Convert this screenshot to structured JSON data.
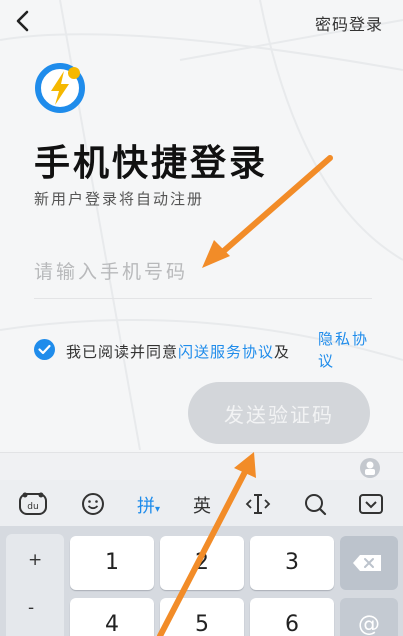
{
  "header": {
    "back_icon": "chevron-left-icon",
    "password_login": "密码登录"
  },
  "logo": {
    "icon": "lightning-bolt-logo"
  },
  "title": "手机快捷登录",
  "subtitle": "新用户登录将自动注册",
  "phone_input": {
    "placeholder": "请输入手机号码",
    "value": ""
  },
  "agreement": {
    "checked": true,
    "prefix": "我已阅读并同意",
    "link1": "闪送服务协议",
    "and": "及",
    "link2": "隐私协议"
  },
  "send_button": {
    "label": "发送验证码"
  },
  "keyboard": {
    "toolbar": [
      {
        "icon": "du-logo-icon"
      },
      {
        "icon": "emoji-icon"
      },
      {
        "label": "拼",
        "active": true,
        "suffix": "▾"
      },
      {
        "label": "英"
      },
      {
        "icon": "cursor-icon"
      },
      {
        "icon": "search-icon"
      },
      {
        "icon": "keyboard-collapse-icon"
      }
    ],
    "side_keys": [
      "+",
      "-"
    ],
    "number_keys": [
      "1",
      "2",
      "3",
      "4",
      "5",
      "6"
    ],
    "func_keys": [
      {
        "icon": "backspace-icon"
      },
      {
        "label": "@"
      }
    ]
  },
  "colors": {
    "accent": "#1f8ceb",
    "button_disabled": "#d3d6da",
    "arrow": "#f28c28"
  }
}
